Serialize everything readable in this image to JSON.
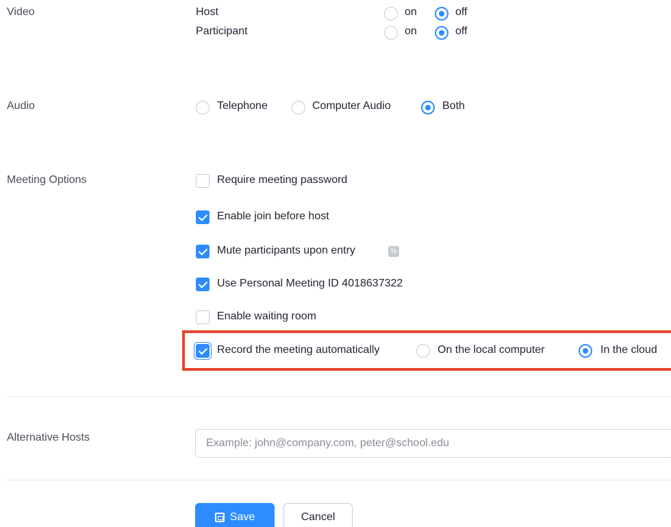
{
  "video": {
    "label": "Video",
    "host_label": "Host",
    "participant_label": "Participant",
    "on_label": "on",
    "off_label": "off",
    "host_value": "off",
    "participant_value": "off"
  },
  "audio": {
    "label": "Audio",
    "options": [
      "Telephone",
      "Computer Audio",
      "Both"
    ],
    "selected": "Both"
  },
  "meeting_options": {
    "label": "Meeting Options",
    "require_password": {
      "label": "Require meeting password",
      "checked": false
    },
    "join_before_host": {
      "label": "Enable join before host",
      "checked": true
    },
    "mute_on_entry": {
      "label": "Mute participants upon entry",
      "checked": true
    },
    "personal_meeting_id": {
      "label": "Use Personal Meeting ID 4018637322",
      "checked": true
    },
    "waiting_room": {
      "label": "Enable waiting room",
      "checked": false
    },
    "record_auto": {
      "label": "Record the meeting automatically",
      "checked": true,
      "local_label": "On the local computer",
      "cloud_label": "In the cloud",
      "selected": "In the cloud"
    }
  },
  "alternative_hosts": {
    "label": "Alternative Hosts",
    "placeholder": "Example: john@company.com, peter@school.edu",
    "value": ""
  },
  "actions": {
    "save_label": "Save",
    "cancel_label": "Cancel"
  },
  "colors": {
    "accent": "#2d8cff",
    "highlight": "#e8432d"
  }
}
